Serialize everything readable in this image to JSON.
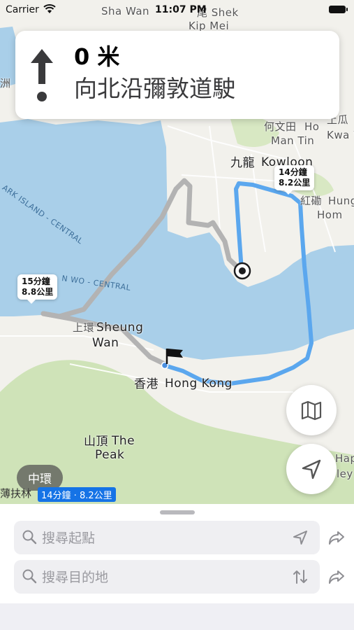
{
  "status_bar": {
    "carrier": "Carrier",
    "time": "11:07 PM"
  },
  "navigation": {
    "distance": "0 米",
    "instruction": "向北沿彌敦道駛"
  },
  "map": {
    "labels": {
      "sha_wan": "Sha Wan",
      "kip_mei": "Kip Mei",
      "shek": "尾 Shek",
      "kowloon_cn": "九龍",
      "kowloon_en": "Kowloon",
      "man_tin_cn": "何文田",
      "ho": "Ho",
      "man_tin": "Man Tin",
      "kwa_cn": "土瓜",
      "kwa_wan": "Kwa W",
      "hung_hom_cn": "紅磡",
      "hung": "Hung",
      "hom": "Hom",
      "sheung_cn": "上環",
      "sheung": "Sheung",
      "wan": "Wan",
      "hong_kong_cn": "香港",
      "hong_kong": "Hong Kong",
      "the_peak_cn": "山頂",
      "the": "The",
      "peak": "Peak",
      "hap": "Hap",
      "ley": "ley",
      "island_central": "ARK ISLAND - CENTRAL",
      "wo_central": "N WO - CENTRAL",
      "zhou": "洲",
      "pok_fu_lam": "薄扶林"
    },
    "route_main_bubble": {
      "time": "14分鐘",
      "distance": "8.2公里"
    },
    "route_alt_bubble": {
      "time": "15分鐘",
      "distance": "8.8公里"
    },
    "district_pill": "中環",
    "eta_summary": "14分鐘 · 8.2公里",
    "colors": {
      "water": "#a9cfe9",
      "land": "#f2f1ec",
      "park": "#cfe3b8",
      "route_main": "#5ba7ee",
      "route_alt": "#b8b8b8"
    },
    "map_button_icon": "map-icon",
    "locate_button_icon": "location-arrow-icon"
  },
  "search": {
    "start_placeholder": "搜尋起點",
    "destination_placeholder": "搜尋目的地"
  }
}
